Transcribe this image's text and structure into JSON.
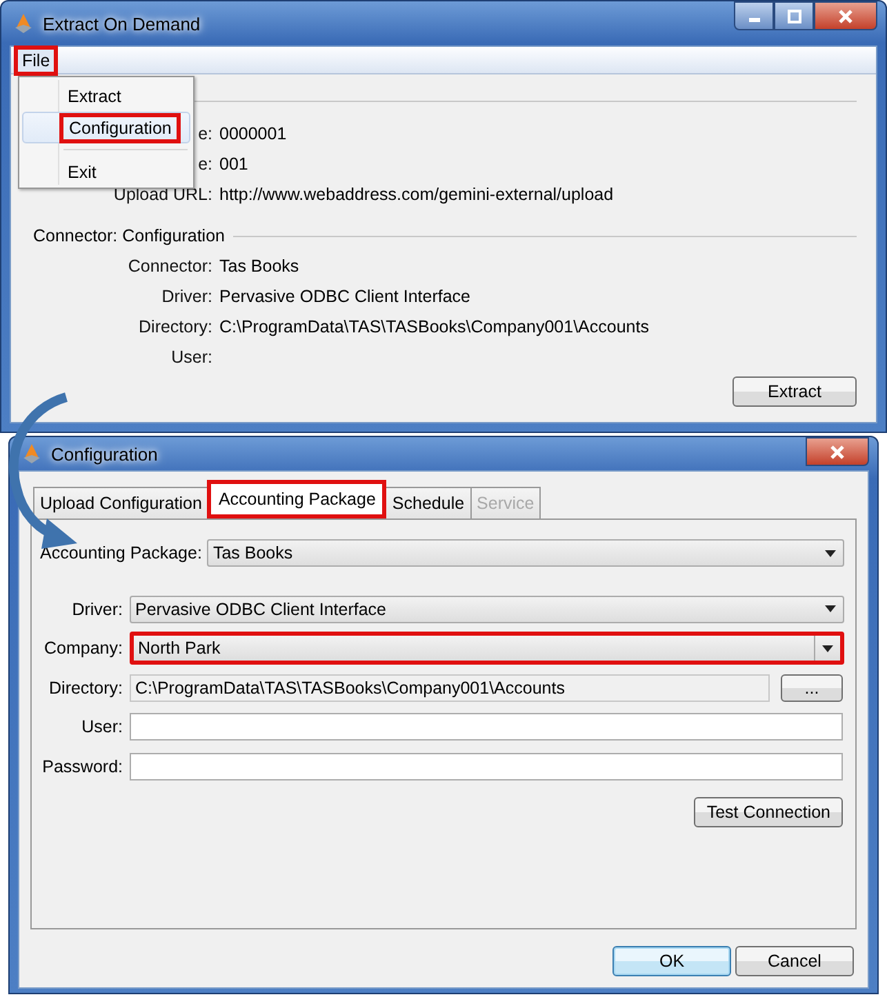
{
  "main_window": {
    "title": "Extract On Demand",
    "menu": [
      {
        "label": "File",
        "open": true,
        "highlighted": true
      }
    ],
    "file_menu": [
      {
        "kind": "item",
        "label": "Extract",
        "selected": false,
        "highlighted": false
      },
      {
        "kind": "item",
        "label": "Configuration",
        "selected": true,
        "highlighted": true
      },
      {
        "kind": "separator"
      },
      {
        "kind": "item",
        "label": "Exit",
        "selected": false,
        "highlighted": false
      }
    ],
    "upload_rows": [
      {
        "label": "e:",
        "value": "0000001"
      },
      {
        "label": "e:",
        "value": "001"
      },
      {
        "label": "Upload URL:",
        "value": "http://www.webaddress.com/gemini-external/upload"
      }
    ],
    "connector_section": {
      "title": "Connector: Configuration",
      "rows": [
        {
          "label": "Connector:",
          "value": "Tas Books"
        },
        {
          "label": "Driver:",
          "value": "Pervasive ODBC Client Interface"
        },
        {
          "label": "Directory:",
          "value": "C:\\ProgramData\\TAS\\TASBooks\\Company001\\Accounts"
        },
        {
          "label": "User:"
        }
      ]
    },
    "extract_button": "Extract"
  },
  "config_window": {
    "title": "Configuration",
    "tabs": [
      {
        "label": "Upload Configuration",
        "selected": false,
        "disabled": false,
        "highlighted": false
      },
      {
        "label": "Accounting Package",
        "selected": true,
        "disabled": false,
        "highlighted": true
      },
      {
        "label": "Schedule",
        "selected": false,
        "disabled": false,
        "highlighted": false
      },
      {
        "label": "Service",
        "selected": false,
        "disabled": true,
        "highlighted": false
      }
    ],
    "accounting_package": {
      "label": "Accounting Package:",
      "value": "Tas Books"
    },
    "fields": [
      {
        "kind": "combo",
        "label": "Driver:",
        "value": "Pervasive ODBC Client Interface",
        "highlighted": false
      },
      {
        "kind": "combo",
        "label": "Company:",
        "value": "North Park",
        "highlighted": true
      },
      {
        "kind": "browse",
        "label": "Directory:",
        "value": "C:\\ProgramData\\TAS\\TASBooks\\Company001\\Accounts",
        "button": "..."
      },
      {
        "kind": "text",
        "label": "User:"
      },
      {
        "kind": "text",
        "label": "Password:"
      }
    ],
    "test_button": "Test Connection",
    "buttons": [
      {
        "label": "OK",
        "default": true
      },
      {
        "label": "Cancel",
        "default": false
      }
    ]
  }
}
